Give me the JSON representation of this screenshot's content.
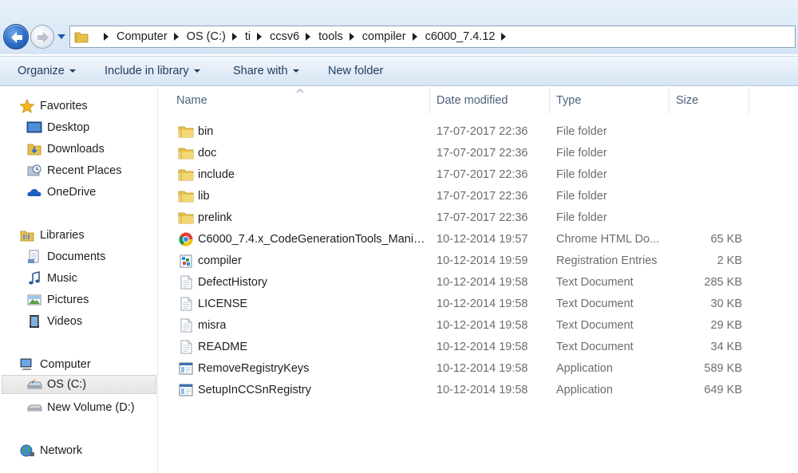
{
  "address": {
    "crumbs": [
      "Computer",
      "OS (C:)",
      "ti",
      "ccsv6",
      "tools",
      "compiler",
      "c6000_7.4.12"
    ]
  },
  "toolbar": {
    "organize": "Organize",
    "include_in_library": "Include in library",
    "share_with": "Share with",
    "new_folder": "New folder"
  },
  "sidebar": {
    "favorites": "Favorites",
    "desktop": "Desktop",
    "downloads": "Downloads",
    "recent_places": "Recent Places",
    "onedrive": "OneDrive",
    "libraries": "Libraries",
    "documents": "Documents",
    "music": "Music",
    "pictures": "Pictures",
    "videos": "Videos",
    "computer": "Computer",
    "os_c": "OS (C:)",
    "new_volume_d": "New Volume (D:)",
    "network": "Network"
  },
  "columns": {
    "name": "Name",
    "date_modified": "Date modified",
    "type": "Type",
    "size": "Size"
  },
  "files": [
    {
      "name": "bin",
      "date": "17-07-2017 22:36",
      "type": "File folder",
      "size": "",
      "icon": "folder-icon"
    },
    {
      "name": "doc",
      "date": "17-07-2017 22:36",
      "type": "File folder",
      "size": "",
      "icon": "folder-icon"
    },
    {
      "name": "include",
      "date": "17-07-2017 22:36",
      "type": "File folder",
      "size": "",
      "icon": "folder-icon"
    },
    {
      "name": "lib",
      "date": "17-07-2017 22:36",
      "type": "File folder",
      "size": "",
      "icon": "folder-icon"
    },
    {
      "name": "prelink",
      "date": "17-07-2017 22:36",
      "type": "File folder",
      "size": "",
      "icon": "folder-icon"
    },
    {
      "name": "C6000_7.4.x_CodeGenerationTools_Manif...",
      "date": "10-12-2014 19:57",
      "type": "Chrome HTML Do...",
      "size": "65 KB",
      "icon": "chrome-icon"
    },
    {
      "name": "compiler",
      "date": "10-12-2014 19:59",
      "type": "Registration Entries",
      "size": "2 KB",
      "icon": "registry-icon"
    },
    {
      "name": "DefectHistory",
      "date": "10-12-2014 19:58",
      "type": "Text Document",
      "size": "285 KB",
      "icon": "text-document-icon"
    },
    {
      "name": "LICENSE",
      "date": "10-12-2014 19:58",
      "type": "Text Document",
      "size": "30 KB",
      "icon": "text-document-icon"
    },
    {
      "name": "misra",
      "date": "10-12-2014 19:58",
      "type": "Text Document",
      "size": "29 KB",
      "icon": "text-document-icon"
    },
    {
      "name": "README",
      "date": "10-12-2014 19:58",
      "type": "Text Document",
      "size": "34 KB",
      "icon": "text-document-icon"
    },
    {
      "name": "RemoveRegistryKeys",
      "date": "10-12-2014 19:58",
      "type": "Application",
      "size": "589 KB",
      "icon": "application-icon"
    },
    {
      "name": "SetupInCCSnRegistry",
      "date": "10-12-2014 19:58",
      "type": "Application",
      "size": "649 KB",
      "icon": "application-icon"
    }
  ]
}
